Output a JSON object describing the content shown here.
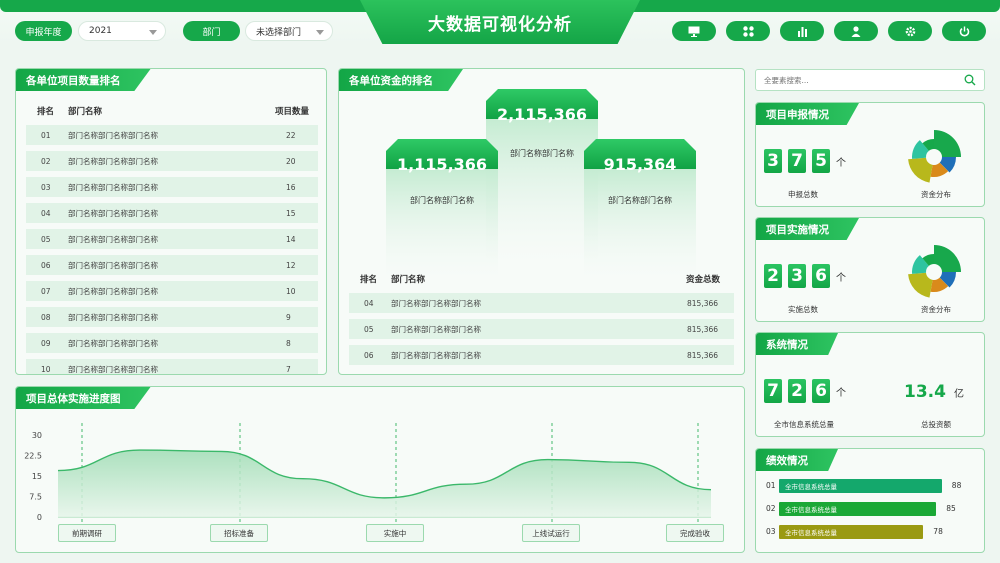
{
  "app": {
    "title": "大数据可视化分析"
  },
  "filters": {
    "year_label": "申报年度",
    "year_value": "2021",
    "dept_label": "部门",
    "dept_value": "未选择部门"
  },
  "colors": {
    "accent": "#16a84a",
    "light": "#e1f3e7"
  },
  "toolbar_icons": [
    "monitor-icon",
    "grid-icon",
    "bar-chart-icon",
    "user-icon",
    "gear-icon",
    "power-icon"
  ],
  "project_rank": {
    "title": "各单位项目数量排名",
    "headers": [
      "排名",
      "部门名称",
      "项目数量"
    ],
    "rows": [
      {
        "rank": "01",
        "name": "部门名称部门名称部门名称",
        "count": "22"
      },
      {
        "rank": "02",
        "name": "部门名称部门名称部门名称",
        "count": "20"
      },
      {
        "rank": "03",
        "name": "部门名称部门名称部门名称",
        "count": "16"
      },
      {
        "rank": "04",
        "name": "部门名称部门名称部门名称",
        "count": "15"
      },
      {
        "rank": "05",
        "name": "部门名称部门名称部门名称",
        "count": "14"
      },
      {
        "rank": "06",
        "name": "部门名称部门名称部门名称",
        "count": "12"
      },
      {
        "rank": "07",
        "name": "部门名称部门名称部门名称",
        "count": "10"
      },
      {
        "rank": "08",
        "name": "部门名称部门名称部门名称",
        "count": "9"
      },
      {
        "rank": "09",
        "name": "部门名称部门名称部门名称",
        "count": "8"
      },
      {
        "rank": "10",
        "name": "部门名称部门名称部门名称",
        "count": "7"
      }
    ]
  },
  "fund_rank": {
    "title": "各单位资金的排名",
    "podium": [
      {
        "value": "2,115,366",
        "name": "部门名称部门名称"
      },
      {
        "value": "1,115,366",
        "name": "部门名称部门名称"
      },
      {
        "value": "915,364",
        "name": "部门名称部门名称"
      }
    ],
    "headers": [
      "排名",
      "部门名称",
      "资金总数"
    ],
    "rows": [
      {
        "rank": "04",
        "name": "部门名称部门名称部门名称",
        "amount": "815,366"
      },
      {
        "rank": "05",
        "name": "部门名称部门名称部门名称",
        "amount": "815,366"
      },
      {
        "rank": "06",
        "name": "部门名称部门名称部门名称",
        "amount": "815,366"
      }
    ]
  },
  "progress": {
    "title": "项目总体实施进度图",
    "yticks": [
      "30",
      "22.5",
      "15",
      "7.5",
      "0"
    ],
    "milestones": [
      "前期调研",
      "招标准备",
      "实施中",
      "上线试运行",
      "完成验收"
    ]
  },
  "chart_data": {
    "type": "area",
    "title": "项目总体实施进度图",
    "ylim": [
      0,
      30
    ],
    "x": [
      "前期调研",
      "",
      "招标准备",
      "",
      "实施中",
      "",
      "上线试运行",
      "",
      "完成验收"
    ],
    "series": [
      {
        "values": [
          17,
          24.5,
          24,
          14,
          7,
          12,
          21,
          20,
          10
        ]
      }
    ]
  },
  "search": {
    "placeholder": "全要素搜索..."
  },
  "report": {
    "title": "项目申报情况",
    "digits": [
      "3",
      "7",
      "5"
    ],
    "unit": "个",
    "count_label": "申报总数",
    "pie_label": "资金分布"
  },
  "implement": {
    "title": "项目实施情况",
    "digits": [
      "2",
      "3",
      "6"
    ],
    "unit": "个",
    "count_label": "实施总数",
    "pie_label": "资金分布"
  },
  "system": {
    "title": "系统情况",
    "digits": [
      "7",
      "2",
      "6"
    ],
    "unit": "个",
    "count_label": "全市信息系统总量",
    "invest_value": "13.4",
    "invest_unit": "亿",
    "invest_label": "总投资额"
  },
  "performance": {
    "title": "绩效情况",
    "rows": [
      {
        "idx": "01",
        "label": "全市信息系统总量",
        "value": "88",
        "color": "#14a86c"
      },
      {
        "idx": "02",
        "label": "全市信息系统总量",
        "value": "85",
        "color": "#1aa836"
      },
      {
        "idx": "03",
        "label": "全市信息系统总量",
        "value": "78",
        "color": "#9a9a12"
      }
    ]
  }
}
